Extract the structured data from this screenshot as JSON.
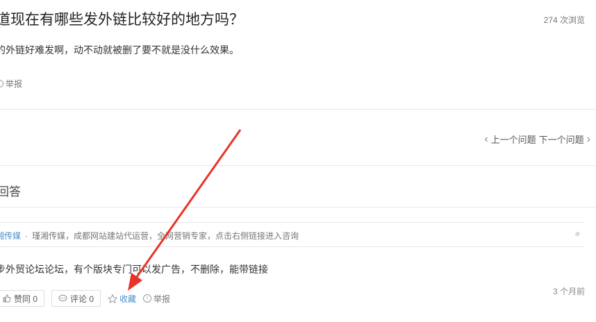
{
  "question": {
    "title": "道现在有哪些发外链比较好的地方吗？",
    "views": "274 次浏览",
    "description": "的外链好难发啊，动不动就被删了要不就是没什么效果。",
    "report_label": "举报"
  },
  "navigation": {
    "prev_label": "上一个问题",
    "next_label": "下一个问题"
  },
  "answers_section": {
    "heading": "回答"
  },
  "answer": {
    "author_name": "湘传媒",
    "separator": "·",
    "author_bio": "瑾湘传媒，成都网站建站代运营，全网营销专家，点击右侧链接进入咨询",
    "content": "步外贸论坛论坛，有个版块专门可以发广告，不删除，能带链接",
    "time": "3 个月前",
    "agree_label": "赞同 0",
    "comment_label": "评论 0",
    "favorite_label": "收藏",
    "report_label": "举报"
  },
  "colors": {
    "accent": "#4a8fd0",
    "annotation_arrow": "#e8332a"
  },
  "icons": [
    "alert-circle-icon",
    "chevron-left-icon",
    "chevron-right-icon",
    "link-icon",
    "thumbs-up-icon",
    "comment-icon",
    "star-icon",
    "annotation-arrow"
  ]
}
